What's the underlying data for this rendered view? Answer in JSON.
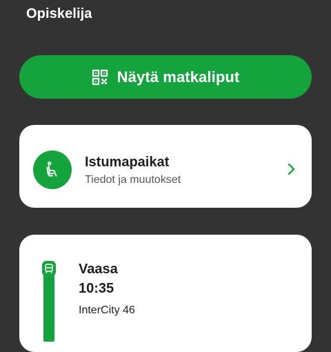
{
  "header": {
    "passenger_type": "Opiskelija"
  },
  "tickets_button": {
    "label": "Näytä matkaliput",
    "icon": "qr-code-icon"
  },
  "seats_card": {
    "title": "Istumapaikat",
    "subtitle": "Tiedot ja muutokset",
    "icon": "seat-icon",
    "chevron": "chevron-right-icon"
  },
  "journey": {
    "station": "Vaasa",
    "time": "10:35",
    "train": "InterCity 46",
    "icon": "train-icon"
  },
  "colors": {
    "background": "#333333",
    "accent": "#14a33d",
    "card": "#ffffff"
  }
}
